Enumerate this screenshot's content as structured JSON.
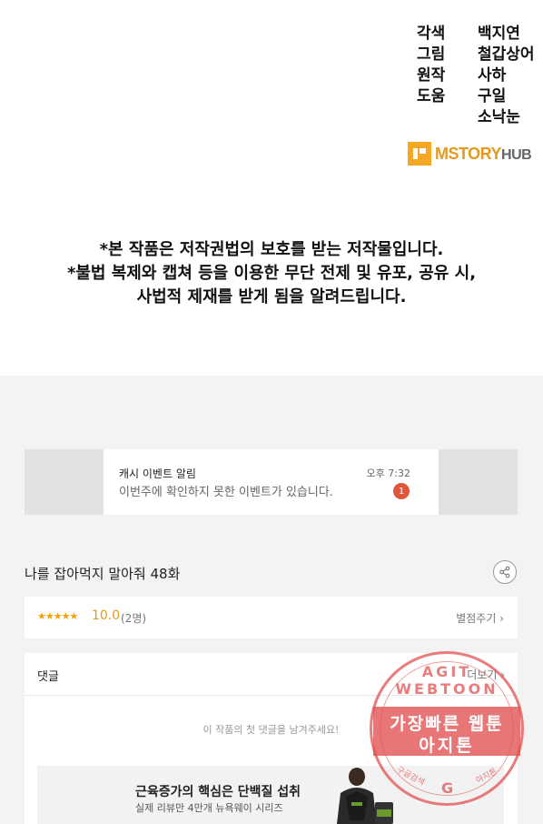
{
  "credits": [
    {
      "role": "각색",
      "names": [
        "백지연"
      ]
    },
    {
      "role": "그림",
      "names": [
        "철갑상어"
      ]
    },
    {
      "role": "원작",
      "names": [
        "사하"
      ]
    },
    {
      "role": "도움",
      "names": [
        "구일",
        "소낙눈"
      ]
    }
  ],
  "logo": {
    "brand": "MSTORY",
    "suffix": "HUB"
  },
  "notice": {
    "line1": "*본 작품은 저작권법의 보호를 받는 저작물입니다.",
    "line2": "*불법 복제와 캡쳐 등을 이용한 무단 전제 및 유포, 공유 시,",
    "line3": "사법적 제재를 받게 됨을 알려드립니다."
  },
  "notification": {
    "title": "캐시 이벤트 알림",
    "message": "이번주에 확인하지 못한 이벤트가 있습니다.",
    "time": "오후 7:32",
    "badge": "1"
  },
  "episode": {
    "title": "나를 잡아먹지 말아줘 48화",
    "share_icon": "share-icon"
  },
  "rating": {
    "stars": "★★★★★",
    "score": "10.0",
    "count": "(2명)",
    "rate_label": "별점주기 ›"
  },
  "comments": {
    "title": "댓글",
    "more_label": "더보기 ›",
    "empty_text": "이 작품의 첫 댓글을 남겨주세요!"
  },
  "ad": {
    "title": "근육증가의 핵심은 단백질 섭취",
    "subtitle": "실제 리뷰만 4만개 뉴욕웨이 시리즈"
  },
  "watermark": {
    "ring_text": "AGIT WEBTOON",
    "band_line1": "가장빠른 웹툰",
    "band_line2": "아지톤",
    "bottom_left": "구글검색",
    "bottom_right": "아지톤",
    "center_letter": "G"
  },
  "colors": {
    "accent": "#e39a1d",
    "badge": "#e2553b",
    "stamp": "#e15050"
  }
}
